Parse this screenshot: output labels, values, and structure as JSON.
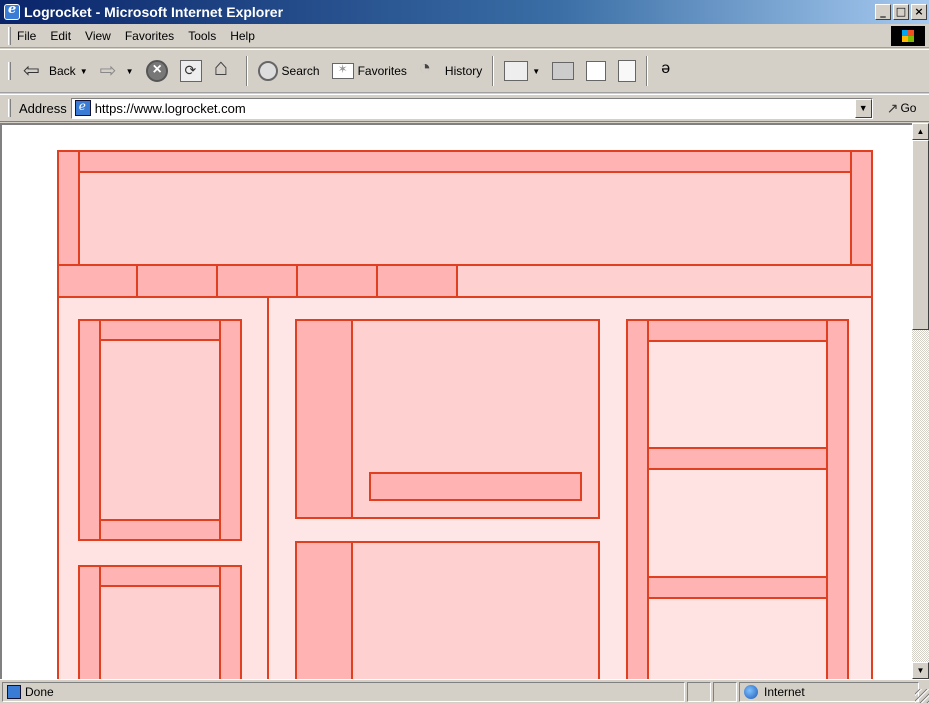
{
  "window": {
    "title": "Logrocket - Microsoft Internet Explorer",
    "controls": [
      "minimize",
      "maximize",
      "close"
    ]
  },
  "menu": {
    "items": [
      "File",
      "Edit",
      "View",
      "Favorites",
      "Tools",
      "Help"
    ]
  },
  "toolbar": {
    "back_label": "Back",
    "search_label": "Search",
    "favorites_label": "Favorites",
    "history_label": "History"
  },
  "address": {
    "label": "Address",
    "url": "https://www.logrocket.com",
    "go_label": "Go"
  },
  "status": {
    "text": "Done",
    "zone": "Internet"
  },
  "colors": {
    "wireframe_stroke": "#e04020",
    "wireframe_fill": "#ffd0d0",
    "wireframe_fill_dark": "#ffb3b3",
    "titlebar": "#0a246a"
  }
}
